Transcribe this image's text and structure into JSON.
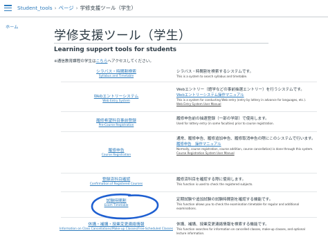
{
  "breadcrumb": {
    "course": "Student_tools",
    "section": "ページ",
    "current": "学修支援ツール（学生）"
  },
  "sidebar": {
    "home": "ホーム"
  },
  "page": {
    "title": "学修支援ツール（学生）",
    "subtitle": "Learning support tools for students",
    "notice_prefix": "※通信教育課程の学生は",
    "notice_link": "こちら",
    "notice_suffix": "へアクセスしてください。"
  },
  "tools": [
    {
      "name_jp": "シラバス・時間割検索",
      "name_en": "Syllabus and Timetable",
      "desc_jp": "シラバス・時間割を検索するシステムです。",
      "desc_en": "This is a system to search syllabus and timetable."
    },
    {
      "name_jp": "Webエントリーシステム",
      "name_en": "Web Entry System",
      "desc_jp": "Webエントリー（語学などの事前抽選エントリー）を行うシステムです。",
      "desc_link": "Webエントリーシステム操作マニュアル",
      "desc_en": "This is a system for conducting Web entry (entry by lottery in advance for languages, etc.).",
      "desc_link_en": "Web Entry System User Manual"
    },
    {
      "name_jp": "履修希望科目事前登録",
      "name_en": "Pre-Course Registration",
      "desc_jp": "履修申告前の抽選登録（一部の学部）で使用します。",
      "desc_en": "Used for lottery entry (in some faculties) prior to course registration."
    },
    {
      "name_jp": "履修申告",
      "name_en": "Course Registration",
      "desc_jp": "通常、履修申告、履修追加申告、履修取消申告の際にこのシステムで行います。",
      "desc_link": "履修申告　操作マニュアル",
      "desc_en": "Normally, course registration, course addition, course cancellation) is done through this system.",
      "desc_link_en": "Course Registration System User Manual"
    },
    {
      "name_jp": "登録済科目確認",
      "name_en": "Confirmation of Registered Courses",
      "desc_jp": "履修済科目を確認する際に使用します。",
      "desc_en": "This function is used to check the registered subjects."
    },
    {
      "name_jp": "試験時間割",
      "name_en": "Exam Timetable",
      "desc_jp": "定期試験や追加試験の試験時間割を確認する機能です。",
      "desc_en": "This function allows you to check the examination timetable for regular and additional examinations."
    },
    {
      "name_jp": "休講・補講・授業変更連絡情報",
      "name_en": "Information on Class Cancellations/Make-up Classes/Free-Scheduled Classes",
      "desc_jp": "休講、補講、授業変更連絡情報を検索する機能です。",
      "desc_en": "This function searches for information on cancelled classes, make-up classes, and optional lecture information."
    }
  ],
  "colors": {
    "link": "#2b7abc",
    "annotation": "#1e5fd1"
  }
}
